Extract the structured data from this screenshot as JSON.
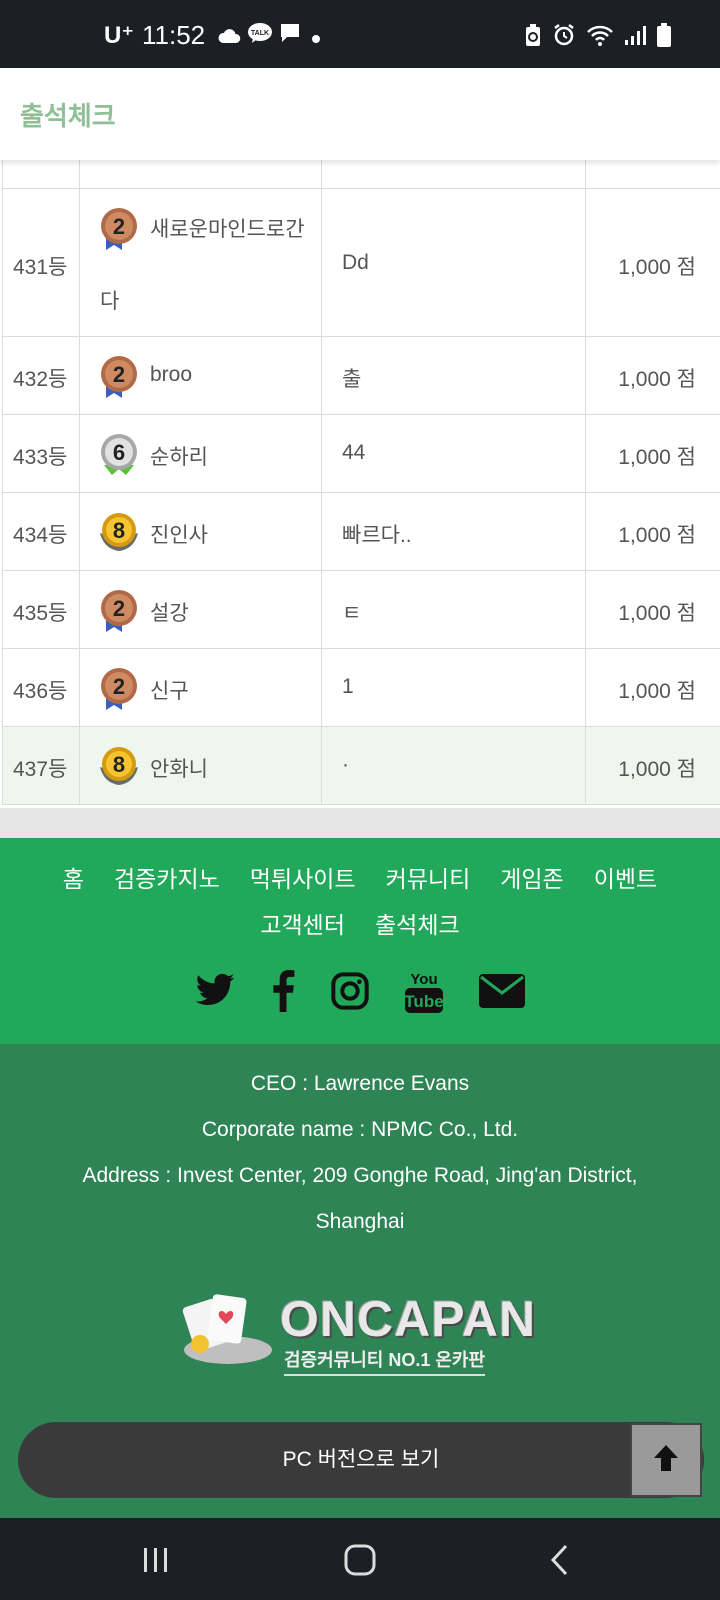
{
  "status_bar": {
    "carrier": "U⁺",
    "time": "11:52",
    "left_icons": [
      "cloud-icon",
      "kakaotalk-icon",
      "message-icon",
      "dot-icon"
    ],
    "right_icons": [
      "battery-saver-icon",
      "alarm-icon",
      "wifi-icon",
      "signal-icon",
      "battery-icon"
    ]
  },
  "header": {
    "title": "출석체크"
  },
  "rankings": [
    {
      "rank": "431등",
      "badge_level": "2",
      "badge_type": "bronze",
      "user": "새로운마인드로간",
      "user_wrap": "다",
      "message": "Dd",
      "points": "1,000 점"
    },
    {
      "rank": "432등",
      "badge_level": "2",
      "badge_type": "bronze",
      "user": "broo",
      "message": "출",
      "points": "1,000 점"
    },
    {
      "rank": "433등",
      "badge_level": "6",
      "badge_type": "silver",
      "user": "순하리",
      "message": "44",
      "points": "1,000 점"
    },
    {
      "rank": "434등",
      "badge_level": "8",
      "badge_type": "gold",
      "user": "진인사",
      "message": "빠르다..",
      "points": "1,000 점"
    },
    {
      "rank": "435등",
      "badge_level": "2",
      "badge_type": "bronze",
      "user": "설강",
      "message": "ㅌ",
      "points": "1,000 점"
    },
    {
      "rank": "436등",
      "badge_level": "2",
      "badge_type": "bronze",
      "user": "신구",
      "message": "1",
      "points": "1,000 점"
    },
    {
      "rank": "437등",
      "badge_level": "8",
      "badge_type": "gold",
      "user": "안화니",
      "message": "·",
      "points": "1,000 점"
    }
  ],
  "footer_nav": {
    "links": [
      "홈",
      "검증카지노",
      "먹튀사이트",
      "커뮤니티",
      "게임존",
      "이벤트",
      "고객센터",
      "출석체크"
    ],
    "social": [
      "twitter-icon",
      "facebook-icon",
      "instagram-icon",
      "youtube-icon",
      "email-icon"
    ]
  },
  "company": {
    "ceo": "CEO : Lawrence Evans",
    "corporate_name": "Corporate name : NPMC Co., Ltd.",
    "address_line1": "Address : Invest Center, 209 Gonghe Road, Jing'an District,",
    "address_line2": "Shanghai",
    "logo_text": "ONCAPAN",
    "logo_sub": "검증커뮤니티 NO.1 온카판"
  },
  "pc_version_label": "PC 버전으로 보기",
  "colors": {
    "header_title": "#8fbf95",
    "footer_nav_bg": "#22a85a",
    "company_bg": "#2e8455",
    "highlight_row": "#edf7ee"
  }
}
